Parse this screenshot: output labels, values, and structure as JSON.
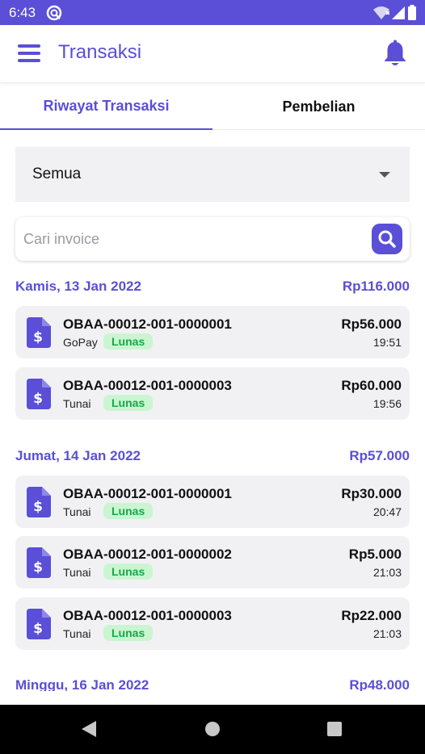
{
  "status_bar": {
    "time": "6:43"
  },
  "app_bar": {
    "title": "Transaksi"
  },
  "tabs": [
    {
      "label": "Riwayat Transaksi",
      "active": true
    },
    {
      "label": "Pembelian",
      "active": false
    }
  ],
  "filter": {
    "selected": "Semua"
  },
  "search": {
    "placeholder": "Cari invoice",
    "value": ""
  },
  "groups": [
    {
      "date": "Kamis, 13 Jan 2022",
      "total": "Rp116.000",
      "transactions": [
        {
          "invoice": "OBAA-00012-001-0000001",
          "method": "GoPay",
          "status": "Lunas",
          "amount": "Rp56.000",
          "time": "19:51"
        },
        {
          "invoice": "OBAA-00012-001-0000003",
          "method": "Tunai",
          "status": "Lunas",
          "amount": "Rp60.000",
          "time": "19:56"
        }
      ]
    },
    {
      "date": "Jumat, 14 Jan 2022",
      "total": "Rp57.000",
      "transactions": [
        {
          "invoice": "OBAA-00012-001-0000001",
          "method": "Tunai",
          "status": "Lunas",
          "amount": "Rp30.000",
          "time": "20:47"
        },
        {
          "invoice": "OBAA-00012-001-0000002",
          "method": "Tunai",
          "status": "Lunas",
          "amount": "Rp5.000",
          "time": "21:03"
        },
        {
          "invoice": "OBAA-00012-001-0000003",
          "method": "Tunai",
          "status": "Lunas",
          "amount": "Rp22.000",
          "time": "21:03"
        }
      ]
    },
    {
      "date": "Minggu, 16 Jan 2022",
      "total": "Rp48.000",
      "transactions": []
    }
  ],
  "colors": {
    "accent": "#5a4fd6",
    "paid_bg": "#c9f6d1",
    "paid_text": "#1aa64a",
    "card_bg": "#f1f1f4"
  },
  "icons": [
    "menu-icon",
    "bell-icon",
    "search-icon",
    "invoice-icon",
    "wifi-icon",
    "signal-icon",
    "battery-icon",
    "nav-back-icon",
    "nav-home-icon",
    "nav-recent-icon"
  ]
}
